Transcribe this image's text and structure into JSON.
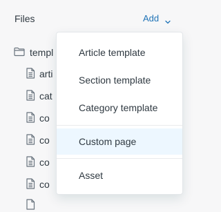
{
  "panel": {
    "title": "Files",
    "add_label": "Add"
  },
  "tree": {
    "folder_label": "templ",
    "files": [
      {
        "label": "arti",
        "icon": "file-icon"
      },
      {
        "label": "cat",
        "icon": "file-icon"
      },
      {
        "label": "co",
        "icon": "file-icon"
      },
      {
        "label": "co",
        "icon": "file-icon"
      },
      {
        "label": "co",
        "icon": "file-icon"
      },
      {
        "label": "co",
        "icon": "file-icon"
      }
    ]
  },
  "menu": {
    "items": [
      {
        "label": "Article template"
      },
      {
        "label": "Section template"
      },
      {
        "label": "Category template"
      },
      {
        "label": "Custom page",
        "highlighted": true
      },
      {
        "label": "Asset"
      }
    ]
  },
  "colors": {
    "accent": "#1f73b7",
    "highlight": "#edf7ff",
    "text": "#2f3941"
  }
}
